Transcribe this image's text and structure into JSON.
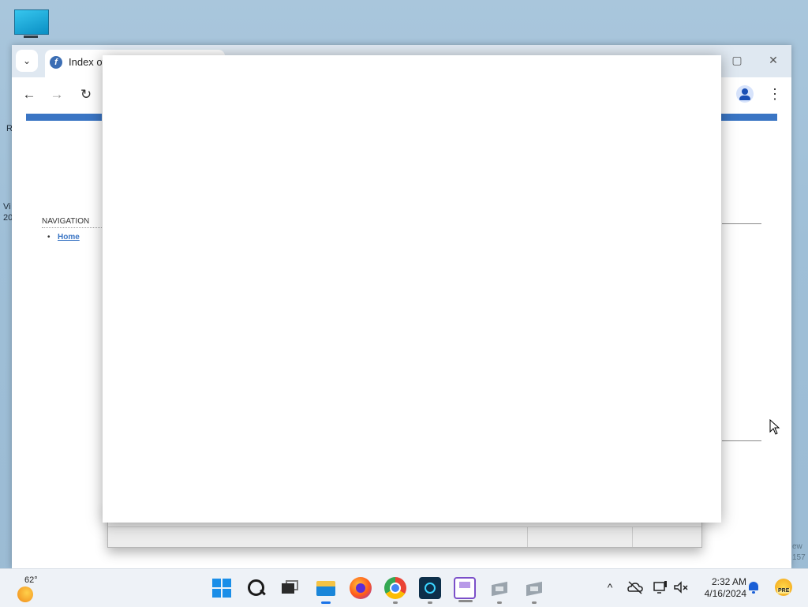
{
  "desktop": {
    "edge_texts": [
      "R",
      "Vi",
      "20"
    ],
    "corner_texts": [
      "ew",
      "157"
    ]
  },
  "browser": {
    "tab_title": "Index of",
    "favicon": "fedora-icon",
    "window_controls": {
      "maximize": "▢",
      "close": "✕"
    },
    "toolbar": {
      "back": "←",
      "forward": "→",
      "reload": "↻",
      "menu": "⋮"
    },
    "accent_color": "#3a75c4"
  },
  "page": {
    "nav_heading": "NAVIGATION",
    "nav_bullet": "•",
    "nav_items": [
      "Home"
    ]
  },
  "taskbar": {
    "weather_temp": "62°",
    "time": "2:32 AM",
    "date": "4/16/2024",
    "tray": {
      "chevron": "^",
      "badge": "PRE"
    }
  }
}
